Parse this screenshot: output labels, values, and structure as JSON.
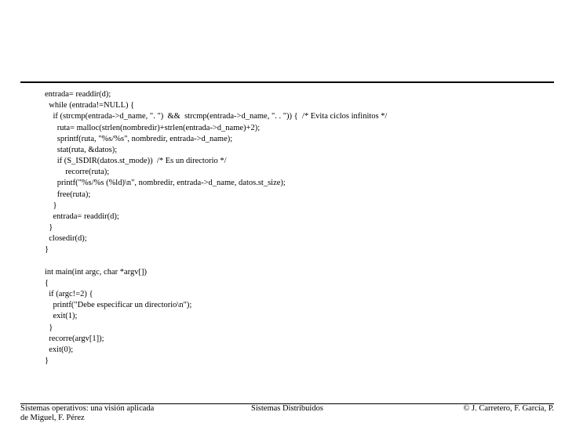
{
  "code": {
    "l1": "entrada= readdir(d);",
    "l2": "  while (entrada!=NULL) {",
    "l3": "    if (strcmp(entrada->d_name, \". \")  &&  strcmp(entrada->d_name, \". . \")) {  /* Evita ciclos infinitos */",
    "l4": "      ruta= malloc(strlen(nombredir)+strlen(entrada->d_name)+2);",
    "l5": "      sprintf(ruta, \"%s/%s\", nombredir, entrada->d_name);",
    "l6": "      stat(ruta, &datos);",
    "l7": "      if (S_ISDIR(datos.st_mode))  /* Es un directorio */",
    "l8": "          recorre(ruta);",
    "l9": "      printf(\"%s/%s (%ld)\\n\", nombredir, entrada->d_name, datos.st_size);",
    "l10": "      free(ruta);",
    "l11": "    }",
    "l12": "    entrada= readdir(d);",
    "l13": "  }",
    "l14": "  closedir(d);",
    "l15": "}",
    "l16": "",
    "l17": "int main(int argc, char *argv[])",
    "l18": "{",
    "l19": "  if (argc!=2) {",
    "l20": "    printf(\"Debe especificar un directorio\\n\");",
    "l21": "    exit(1);",
    "l22": "  }",
    "l23": "  recorre(argv[1]);",
    "l24": "  exit(0);",
    "l25": "}"
  },
  "footer": {
    "left_line1": "Sistemas operativos: una visión aplicada",
    "left_line2": "de Miguel, F. Pérez",
    "center": "Sistemas Distribuidos",
    "right": "© J. Carretero, F. García, P."
  }
}
